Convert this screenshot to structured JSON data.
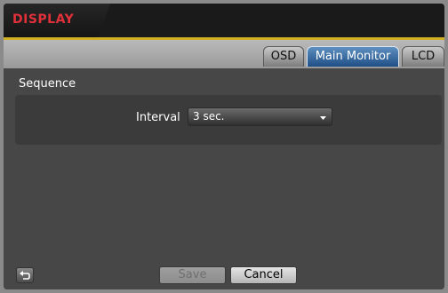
{
  "window": {
    "title": "DISPLAY"
  },
  "tabs": [
    {
      "label": "OSD",
      "active": false
    },
    {
      "label": "Main Monitor",
      "active": true
    },
    {
      "label": "LCD",
      "active": false
    }
  ],
  "section": {
    "label": "Sequence",
    "interval": {
      "label": "Interval",
      "value": "3 sec."
    }
  },
  "buttons": {
    "back_icon": "return-arrow-icon",
    "save": "Save",
    "save_enabled": false,
    "cancel": "Cancel"
  },
  "colors": {
    "title": "#e0303a",
    "accent_line": "#d2b024",
    "active_tab": "#2f639b"
  }
}
